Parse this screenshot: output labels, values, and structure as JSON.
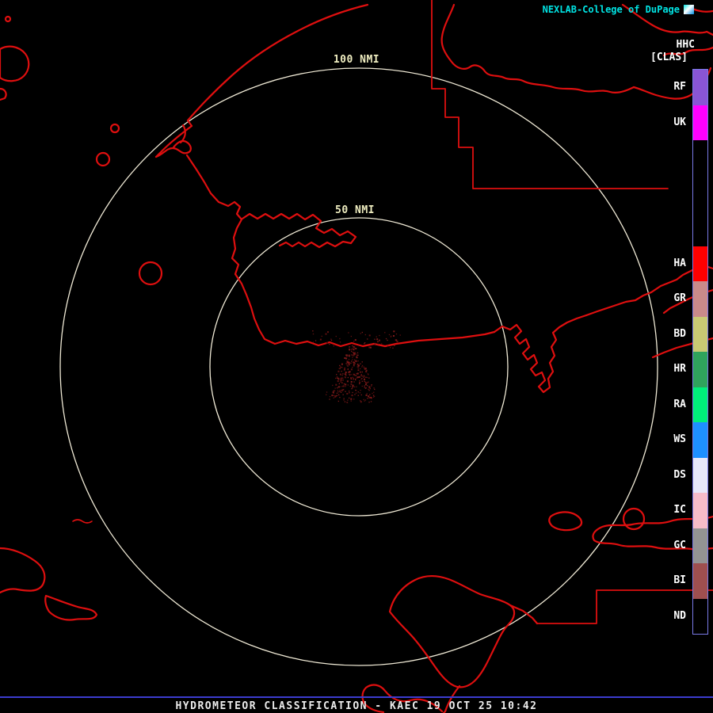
{
  "header": {
    "source_label": "NEXLAB-College of DuPage",
    "product_label": "HHC",
    "class_label": "[CLAS]"
  },
  "map": {
    "ring_labels": [
      "100 NMI",
      "50 NMI"
    ],
    "colors": {
      "boundaries": "#DE0F0F",
      "range_rings": "#EFE9D5",
      "ring_label_text": "#EFEDC0",
      "echo": [
        "#5E1010",
        "#7C1A1A"
      ]
    }
  },
  "legend": {
    "border_color": "#7A7AE8",
    "entries": [
      {
        "label": "RF",
        "color": "#8A55D5"
      },
      {
        "label": "UK",
        "color": "#FF00FF"
      },
      {
        "label": "",
        "color": "#000000"
      },
      {
        "label": "",
        "color": "#000000"
      },
      {
        "label": "",
        "color": "#000000"
      },
      {
        "label": "HA",
        "color": "#FF0000"
      },
      {
        "label": "GR",
        "color": "#C98A8A"
      },
      {
        "label": "BD",
        "color": "#C9C973"
      },
      {
        "label": "HR",
        "color": "#2FA35C"
      },
      {
        "label": "RA",
        "color": "#00EE7A"
      },
      {
        "label": "WS",
        "color": "#1E90FF"
      },
      {
        "label": "DS",
        "color": "#E8E8F8"
      },
      {
        "label": "IC",
        "color": "#F7BCC8"
      },
      {
        "label": "GC",
        "color": "#939393"
      },
      {
        "label": "BI",
        "color": "#9E4F4F"
      },
      {
        "label": "ND",
        "color": "#000000"
      }
    ]
  },
  "footer": {
    "divider_color": "#3C3CCF",
    "title": "HYDROMETEOR CLASSIFICATION - KAEC 19 OCT 25 10:42"
  }
}
